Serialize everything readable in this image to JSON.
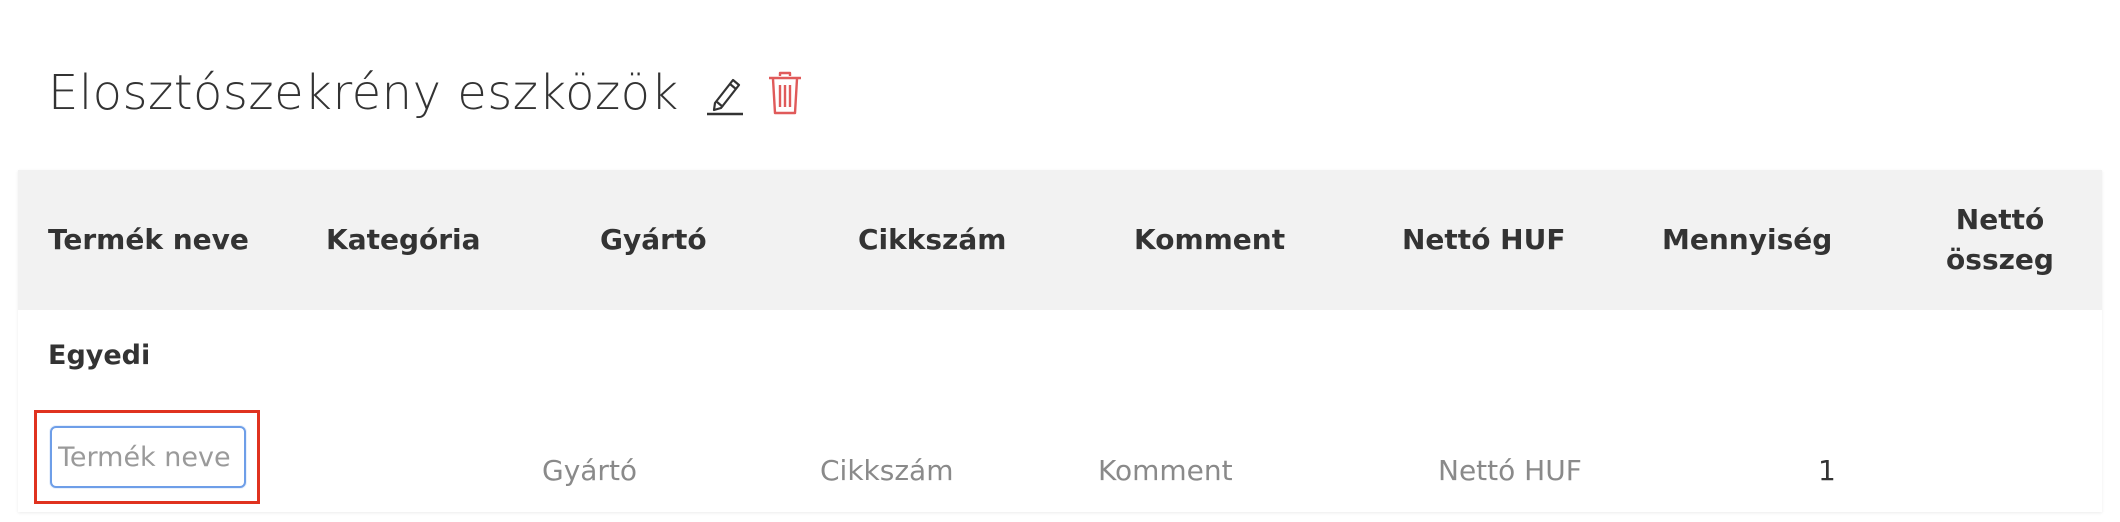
{
  "page": {
    "title": "Elosztószekrény eszközök",
    "edit_icon": "pencil-icon",
    "delete_icon": "trash-icon",
    "delete_color": "#e05a5a"
  },
  "table": {
    "columns": [
      "Termék neve",
      "Kategória",
      "Gyártó",
      "Cikkszám",
      "Komment",
      "Nettó HUF",
      "Mennyiség",
      "Nettó összeg"
    ],
    "header_background": "#f2f2f2",
    "section_label": "Egyedi",
    "new_row": {
      "product_name": {
        "value": "",
        "placeholder": "Termék neve"
      },
      "manufacturer_placeholder": "Gyártó",
      "sku_placeholder": "Cikkszám",
      "comment_placeholder": "Komment",
      "net_huf_placeholder": "Nettó HUF",
      "quantity": "1"
    }
  },
  "highlight_color": "#e0321f"
}
